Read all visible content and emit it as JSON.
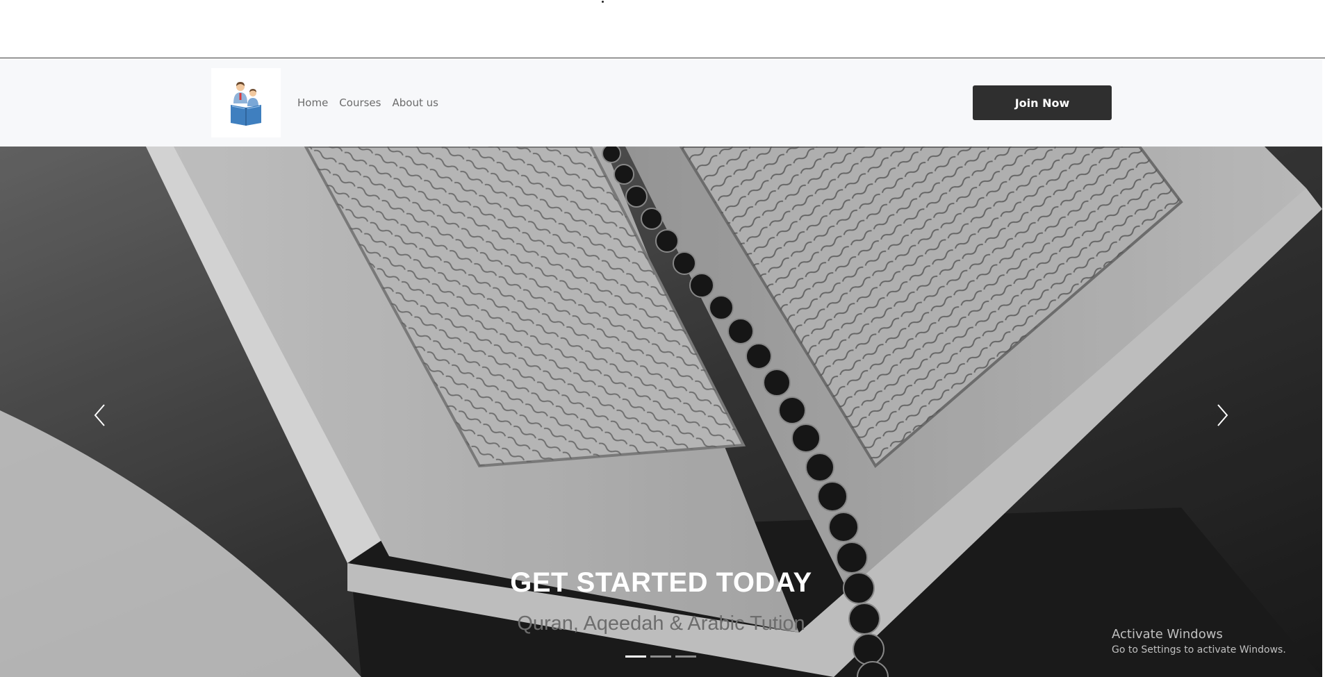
{
  "nav": {
    "logo_icon": "family-reading-icon",
    "links": [
      "Home",
      "Courses",
      "About us"
    ],
    "join_label": "Join Now"
  },
  "hero": {
    "image": "open-quran-with-prayer-beads",
    "prev_icon": "chevron-left-icon",
    "next_icon": "chevron-right-icon",
    "title": "GET STARTED TODAY",
    "subtitle": "Quran, Aqeedah & Arabic Tution",
    "slide_count": 3,
    "active_slide": 1
  },
  "watermark": {
    "title": "Activate Windows",
    "subtitle": "Go to Settings to activate Windows."
  },
  "colors": {
    "navbar_bg": "#f7f8fa",
    "button_bg": "#2f2f2f",
    "caption_title": "#ffffff",
    "caption_subtitle": "#6d6d6d"
  }
}
